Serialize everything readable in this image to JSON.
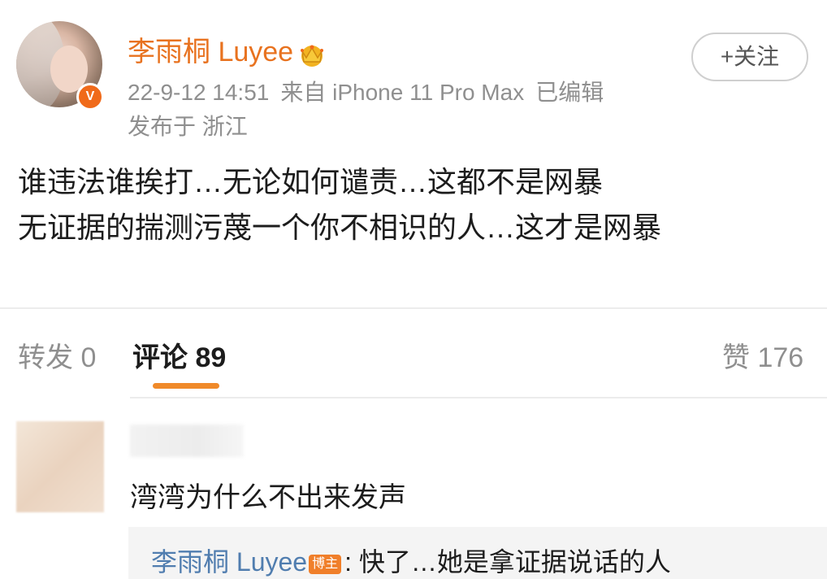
{
  "post": {
    "author": "李雨桐 Luyee",
    "time": "22-9-12 14:51",
    "source": "来自 iPhone 11 Pro Max",
    "edited": "已编辑",
    "location": "发布于 浙江",
    "follow_label": "+关注",
    "verified_badge": "V",
    "text_lines": [
      "谁违法谁挨打…无论如何谴责…这都不是网暴",
      "无证据的揣测污蔑一个你不相识的人…这才是网暴"
    ]
  },
  "tabs": {
    "repost": "转发 0",
    "comments": "评论 89",
    "likes": "赞 176"
  },
  "comment": {
    "text": "湾湾为什么不出来发声",
    "reply": {
      "author": "李雨桐 Luyee",
      "badge": "博主",
      "text": ": 快了…她是拿证据说话的人"
    }
  },
  "colors": {
    "accent": "#e8721f",
    "link": "#507daf",
    "muted": "#8f8f8f",
    "text": "#1c1c1c"
  },
  "icons": {
    "crown": "crown-icon",
    "verified": "verified-v-icon"
  }
}
